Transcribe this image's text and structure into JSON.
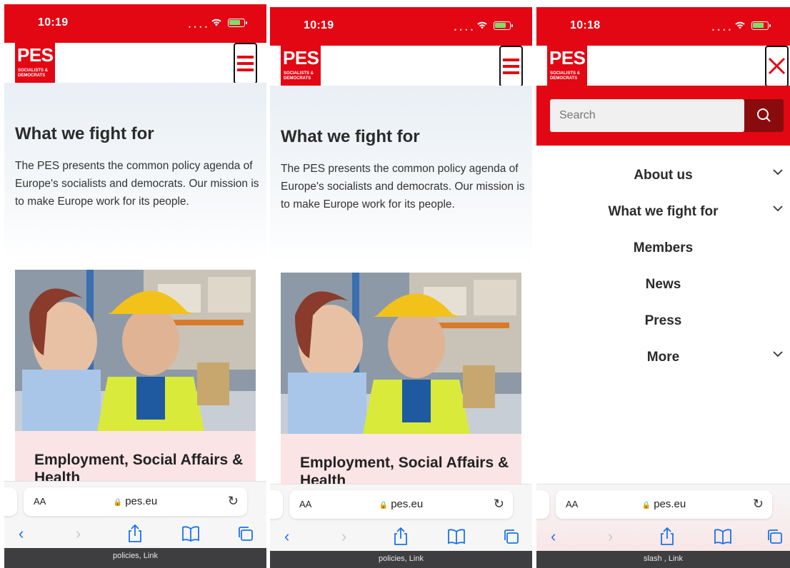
{
  "screens": [
    {
      "time": "10:19",
      "logo": {
        "main": "PES",
        "sub1": "SOCIALISTS &",
        "sub2": "DEMOCRATS"
      },
      "hero": {
        "title": "What we fight for",
        "body": "The PES presents the common policy agenda of Europe's socialists and democrats. Our mission is to make Europe work for its people."
      },
      "card_title": "Employment, Social Affairs & Health",
      "url": "pes.eu",
      "text_size_label": "AA",
      "caption": "policies, Link"
    },
    {
      "time": "10:19",
      "logo": {
        "main": "PES",
        "sub1": "SOCIALISTS &",
        "sub2": "DEMOCRATS"
      },
      "hero": {
        "title": "What we fight for",
        "body": "The PES presents the common policy agenda of Europe's socialists and democrats. Our mission is to make Europe work for its people."
      },
      "card_title": "Employment, Social Affairs & Health",
      "url": "pes.eu",
      "text_size_label": "AA",
      "caption": "policies, Link"
    },
    {
      "time": "10:18",
      "logo": {
        "main": "PES",
        "sub1": "SOCIALISTS &",
        "sub2": "DEMOCRATS"
      },
      "search_placeholder": "Search",
      "menu": [
        {
          "label": "About us",
          "has_submenu": true
        },
        {
          "label": "What we fight for",
          "has_submenu": true
        },
        {
          "label": "Members",
          "has_submenu": false
        },
        {
          "label": "News",
          "has_submenu": false
        },
        {
          "label": "Press",
          "has_submenu": false
        },
        {
          "label": "More",
          "has_submenu": true
        }
      ],
      "url": "pes.eu",
      "text_size_label": "AA",
      "caption": "slash , Link"
    }
  ],
  "colors": {
    "brand_red": "#e30613",
    "dark_red": "#8a0b0e",
    "card_pink": "#fbe4e5",
    "safari_blue": "#1a73e8"
  },
  "icons": [
    "wifi-icon",
    "battery-icon",
    "hamburger-menu-icon",
    "close-icon",
    "search-icon",
    "lock-icon",
    "reload-icon",
    "back-icon",
    "forward-icon",
    "share-icon",
    "bookmarks-icon",
    "tabs-icon",
    "chevron-down-icon"
  ]
}
